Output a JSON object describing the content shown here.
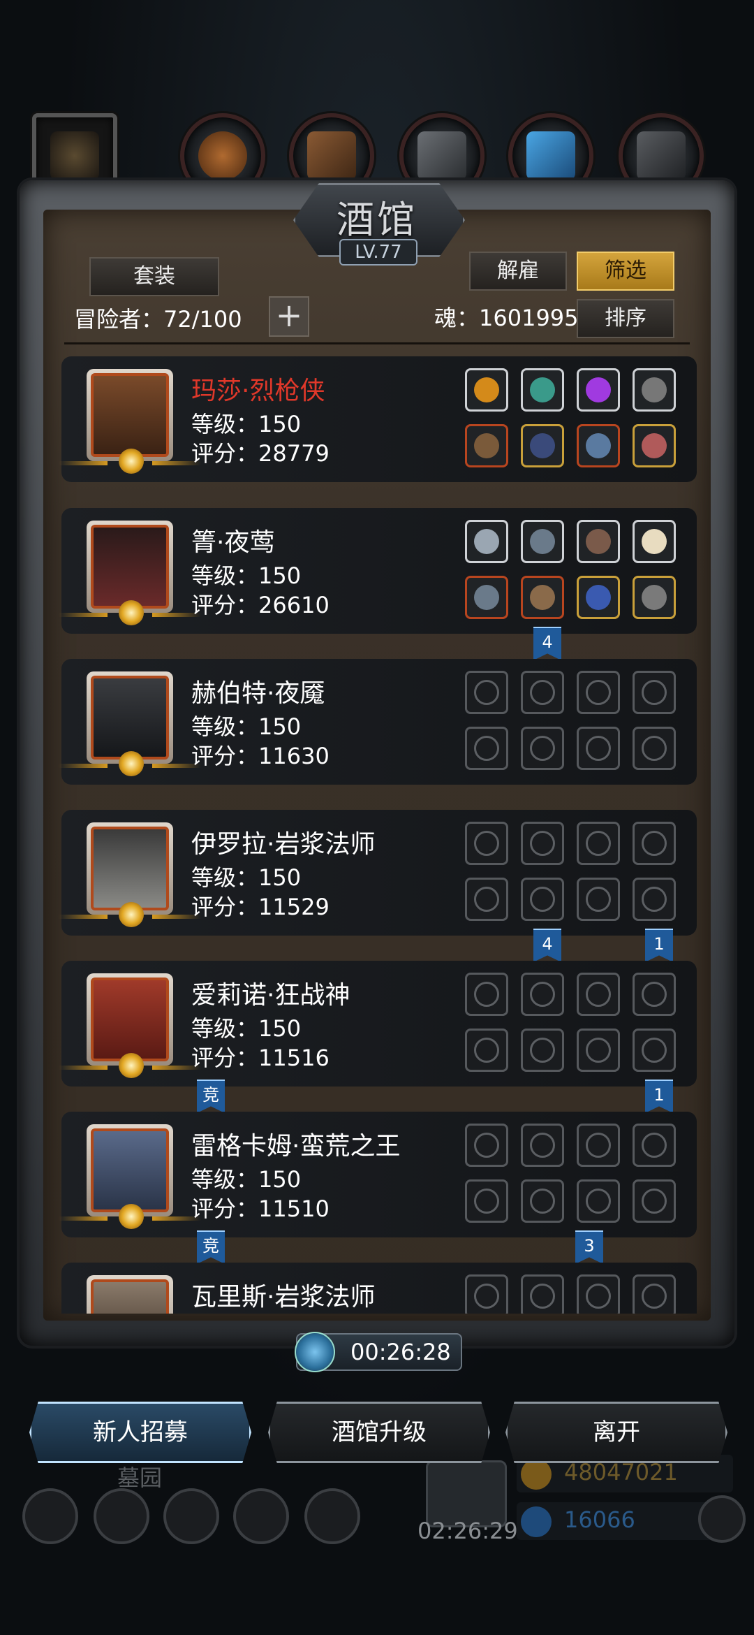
{
  "screen": {
    "title": "酒馆",
    "level": "LV.77"
  },
  "top_tabs": [
    {
      "name": "tab-current",
      "icon": "torch-icon"
    },
    {
      "name": "tab-gourd",
      "icon": "gourd-icon"
    },
    {
      "name": "tab-scroll",
      "icon": "scroll-icon"
    },
    {
      "name": "tab-armor",
      "icon": "armor-icon"
    },
    {
      "name": "tab-crystal",
      "icon": "crystal-icon"
    },
    {
      "name": "tab-boots",
      "icon": "boots-icon"
    }
  ],
  "header": {
    "set_button": "套装",
    "dismiss_button": "解雇",
    "filter_button": "筛选",
    "sort_button": "排序",
    "adventurers_label": "冒险者：72/100",
    "soul_label": "魂：1601995",
    "add_icon": "plus-icon"
  },
  "heroes": [
    {
      "name": "玛莎·烈枪侠",
      "level": "等级：150",
      "score": "评分：28779",
      "name_color": "#e0382a"
    },
    {
      "name": "箐·夜莺",
      "level": "等级：150",
      "score": "评分：26610"
    },
    {
      "name": "赫伯特·夜魇",
      "level": "等级：150",
      "score": "评分：11630"
    },
    {
      "name": "伊罗拉·岩浆法师",
      "level": "等级：150",
      "score": "评分：11529"
    },
    {
      "name": "爱莉诺·狂战神",
      "level": "等级：150",
      "score": "评分：11516"
    },
    {
      "name": "雷格卡姆·蛮荒之王",
      "level": "等级：150",
      "score": "评分：11510"
    },
    {
      "name": "瓦里斯·岩浆法师",
      "level": "",
      "score": ""
    }
  ],
  "tags": {
    "t1": "4",
    "t2": "4",
    "t3": "1",
    "t4": "竞",
    "t5": "1",
    "t6": "竞",
    "t7": "3"
  },
  "timer": "00:26:28",
  "bottom_buttons": {
    "recruit": "新人招募",
    "upgrade": "酒馆升级",
    "leave": "离开"
  },
  "hud": {
    "area_label": "墓园",
    "chest_timer": "02:26:29",
    "gold": "48047021",
    "gems": "16066"
  },
  "colors": {
    "gold_accent": "#d4a43c",
    "hero_red": "#e0382a",
    "flag_blue": "#1f5a9a"
  }
}
